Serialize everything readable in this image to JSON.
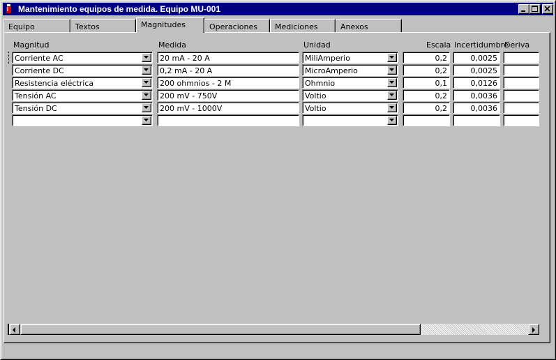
{
  "window": {
    "title": "Mantenimiento equipos de medida. Equipo MU-001",
    "controls": [
      "minimize-icon",
      "maximize-icon",
      "close-icon"
    ]
  },
  "tabs": [
    {
      "label": "Equipo",
      "active": false
    },
    {
      "label": "Textos",
      "active": false
    },
    {
      "label": "Magnitudes",
      "active": true
    },
    {
      "label": "Operaciones",
      "active": false
    },
    {
      "label": "Mediciones",
      "active": false
    },
    {
      "label": "Anexos",
      "active": false
    }
  ],
  "grid": {
    "headers": {
      "magnitud": "Magnitud",
      "medida": "Medida",
      "unidad": "Unidad",
      "escala": "Escala",
      "incertidumbre": "Incertidumbre",
      "deriva": "Deriva"
    },
    "rows": [
      {
        "magnitud": "Corriente AC",
        "medida": "20 mA - 20 A",
        "unidad": "MiliAmperio",
        "escala": "0,2",
        "incertidumbre": "0,0025",
        "deriva": ""
      },
      {
        "magnitud": "Corriente DC",
        "medida": "0,2 mA - 20 A",
        "unidad": "MicroAmperio",
        "escala": "0,2",
        "incertidumbre": "0,0025",
        "deriva": ""
      },
      {
        "magnitud": "Resistencia eléctrica",
        "medida": "200 ohmnios - 2 M",
        "unidad": "Ohmnio",
        "escala": "0,1",
        "incertidumbre": "0,0126",
        "deriva": ""
      },
      {
        "magnitud": "Tensión AC",
        "medida": "200 mV - 750V",
        "unidad": "Voltio",
        "escala": "0,2",
        "incertidumbre": "0,0036",
        "deriva": ""
      },
      {
        "magnitud": "Tensión DC",
        "medida": "200 mV - 1000V",
        "unidad": "Voltio",
        "escala": "0,2",
        "incertidumbre": "0,0036",
        "deriva": ""
      },
      {
        "magnitud": "",
        "medida": "",
        "unidad": "",
        "escala": "",
        "incertidumbre": "",
        "deriva": ""
      }
    ]
  },
  "icons": {
    "dropdown": "chevron-down-icon",
    "scroll_left": "arrow-left-icon",
    "scroll_right": "arrow-right-icon",
    "app": "app-icon"
  },
  "colors": {
    "titlebar": "#000080",
    "face": "#c0c0c0",
    "field": "#ffffff"
  }
}
